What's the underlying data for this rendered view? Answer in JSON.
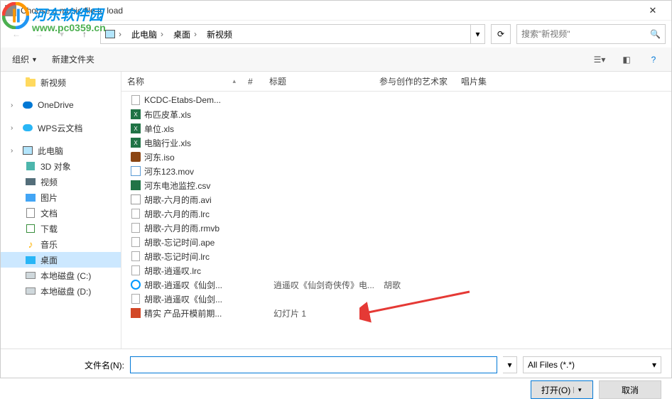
{
  "title": "Choose a music file to load",
  "watermark": {
    "text": "河东软件园",
    "url": "www.pc0359.cn"
  },
  "nav": {
    "breadcrumb": [
      "此电脑",
      "桌面",
      "新视频"
    ],
    "search_placeholder": "搜索\"新视频\""
  },
  "toolbar": {
    "organize": "组织",
    "new_folder": "新建文件夹"
  },
  "sidebar": {
    "items": [
      {
        "label": "新视频",
        "type": "folder",
        "sub": true
      },
      {
        "label": "OneDrive",
        "type": "onedrive"
      },
      {
        "label": "WPS云文档",
        "type": "wps"
      },
      {
        "label": "此电脑",
        "type": "thispc"
      },
      {
        "label": "3D 对象",
        "type": "obj3d",
        "sub": true
      },
      {
        "label": "视频",
        "type": "video",
        "sub": true
      },
      {
        "label": "图片",
        "type": "pic",
        "sub": true
      },
      {
        "label": "文档",
        "type": "docs",
        "sub": true
      },
      {
        "label": "下载",
        "type": "dl",
        "sub": true
      },
      {
        "label": "音乐",
        "type": "music",
        "sub": true
      },
      {
        "label": "桌面",
        "type": "desk",
        "sub": true,
        "selected": true
      },
      {
        "label": "本地磁盘 (C:)",
        "type": "disk",
        "sub": true
      },
      {
        "label": "本地磁盘 (D:)",
        "type": "disk",
        "sub": true
      }
    ]
  },
  "columns": {
    "name": "名称",
    "num": "#",
    "title": "标题",
    "artist": "参与创作的艺术家",
    "album": "唱片集"
  },
  "files": [
    {
      "name": "KCDC-Etabs-Dem...",
      "icon": "doc"
    },
    {
      "name": "布匹皮革.xls",
      "icon": "xls"
    },
    {
      "name": "单位.xls",
      "icon": "xls"
    },
    {
      "name": "电脑行业.xls",
      "icon": "xls"
    },
    {
      "name": "河东.iso",
      "icon": "iso"
    },
    {
      "name": "河东123.mov",
      "icon": "mov"
    },
    {
      "name": "河东电池监控.csv",
      "icon": "csv"
    },
    {
      "name": "胡歌-六月的雨.avi",
      "icon": "avi"
    },
    {
      "name": "胡歌-六月的雨.lrc",
      "icon": "doc"
    },
    {
      "name": "胡歌-六月的雨.rmvb",
      "icon": "doc"
    },
    {
      "name": "胡歌-忘记时间.ape",
      "icon": "doc"
    },
    {
      "name": "胡歌-忘记时间.lrc",
      "icon": "doc"
    },
    {
      "name": "胡歌-逍遥叹.lrc",
      "icon": "doc"
    },
    {
      "name": "胡歌-逍遥叹《仙剑...",
      "icon": "mp3",
      "title": "逍遥叹《仙剑奇侠传》电...",
      "artist": "胡歌"
    },
    {
      "name": "胡歌-逍遥叹《仙剑...",
      "icon": "doc"
    },
    {
      "name": "精实 产品开模前期...",
      "icon": "ppt",
      "title": "幻灯片 1"
    }
  ],
  "footer": {
    "filename_label": "文件名(N):",
    "filetype": "All Files (*.*)",
    "open": "打开(O)",
    "cancel": "取消"
  }
}
